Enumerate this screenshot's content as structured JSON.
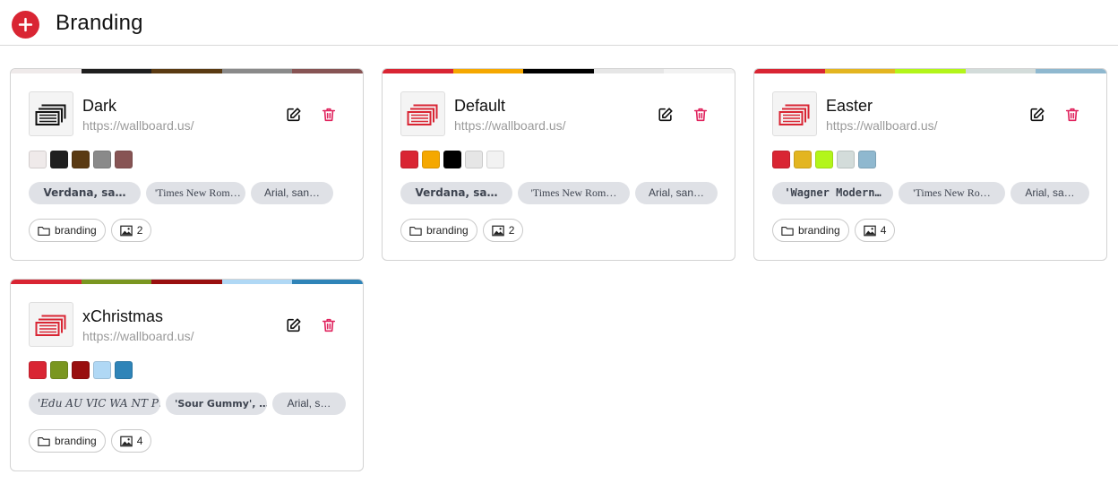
{
  "page": {
    "title": "Branding"
  },
  "icons": {
    "add": "plus-circle-icon",
    "edit": "pencil-square-icon",
    "delete": "trash-icon",
    "folder": "folder-icon",
    "images": "image-icon",
    "logo": "stacked-frames-logo"
  },
  "colors": {
    "accent": "#d92533",
    "delete": "#e0245e",
    "chip_bg": "#dfe1e6"
  },
  "cards": [
    {
      "name": "Dark",
      "url": "https://wallboard.us/",
      "logo_color": "#111111",
      "palette": [
        "#efeaea",
        "#1f1f1f",
        "#5a3a12",
        "#8a8a8a",
        "#875454"
      ],
      "fonts": [
        "Verdana, sa…",
        "'Times New Rom…",
        "Arial, san…"
      ],
      "folder": "branding",
      "image_count": "2"
    },
    {
      "name": "Default",
      "url": "https://wallboard.us/",
      "logo_color": "#d92533",
      "palette": [
        "#d92533",
        "#f5a800",
        "#000000",
        "#e6e6e6",
        "#f2f2f2"
      ],
      "fonts": [
        "Verdana, sa…",
        "'Times New Rom…",
        "Arial, san…"
      ],
      "folder": "branding",
      "image_count": "2"
    },
    {
      "name": "Easter",
      "url": "https://wallboard.us/",
      "logo_color": "#d92533",
      "palette": [
        "#d92533",
        "#e3b520",
        "#b3f51a",
        "#d3dcda",
        "#8fb8cf"
      ],
      "fonts": [
        "'Wagner Modern…",
        "'Times New Ro…",
        "Arial, sa…"
      ],
      "folder": "branding",
      "image_count": "4"
    },
    {
      "name": "xChristmas",
      "url": "https://wallboard.us/",
      "logo_color": "#d92533",
      "palette": [
        "#d92533",
        "#7a9620",
        "#990f0f",
        "#b0d8f5",
        "#2f84b8"
      ],
      "fonts": [
        "'Edu AU VIC WA NT P…",
        "'Sour Gummy', …",
        "Arial, s…"
      ],
      "folder": "branding",
      "image_count": "4"
    }
  ]
}
